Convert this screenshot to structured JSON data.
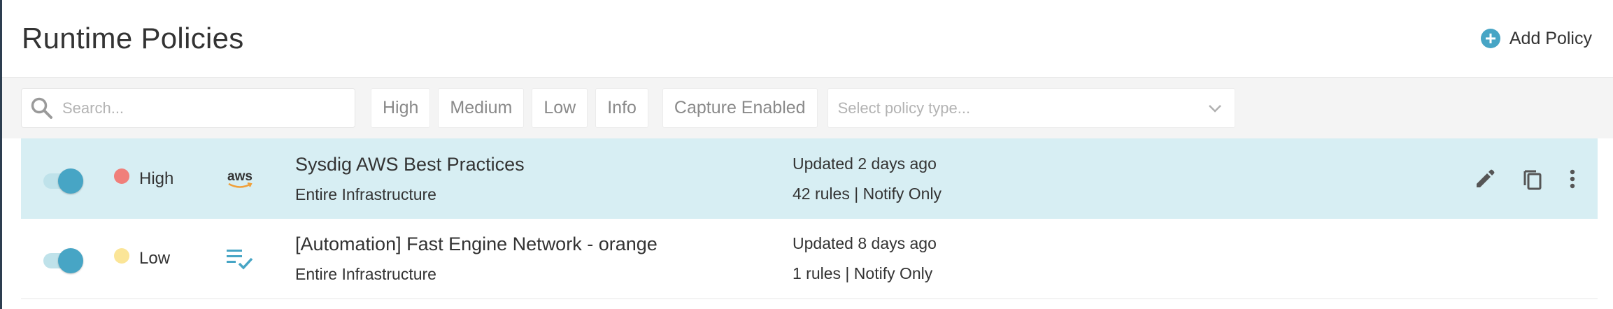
{
  "header": {
    "title": "Runtime Policies",
    "add_policy_label": "Add Policy"
  },
  "filters": {
    "search_placeholder": "Search...",
    "chips": [
      "High",
      "Medium",
      "Low",
      "Info",
      "Capture Enabled"
    ],
    "policy_type_placeholder": "Select policy type..."
  },
  "icons": {
    "add": "plus-circle-icon",
    "search": "search-icon",
    "chevron": "chevron-down-icon",
    "edit": "pencil-icon",
    "copy": "copy-icon",
    "more": "more-vertical-icon"
  },
  "colors": {
    "accent": "#47a5c5",
    "selected_row": "#d7eef3",
    "severity_high": "#f07f7a",
    "severity_low": "#fbe597"
  },
  "policies": [
    {
      "enabled": true,
      "severity": "High",
      "type_icon": "aws",
      "name": "Sysdig AWS Best Practices",
      "scope": "Entire Infrastructure",
      "updated": "Updated 2 days ago",
      "rules_summary": "42 rules | Notify Only"
    },
    {
      "enabled": true,
      "severity": "Low",
      "type_icon": "list-check-icon",
      "name": "[Automation] Fast Engine Network - orange",
      "scope": "Entire Infrastructure",
      "updated": "Updated 8 days ago",
      "rules_summary": "1 rules | Notify Only"
    }
  ]
}
